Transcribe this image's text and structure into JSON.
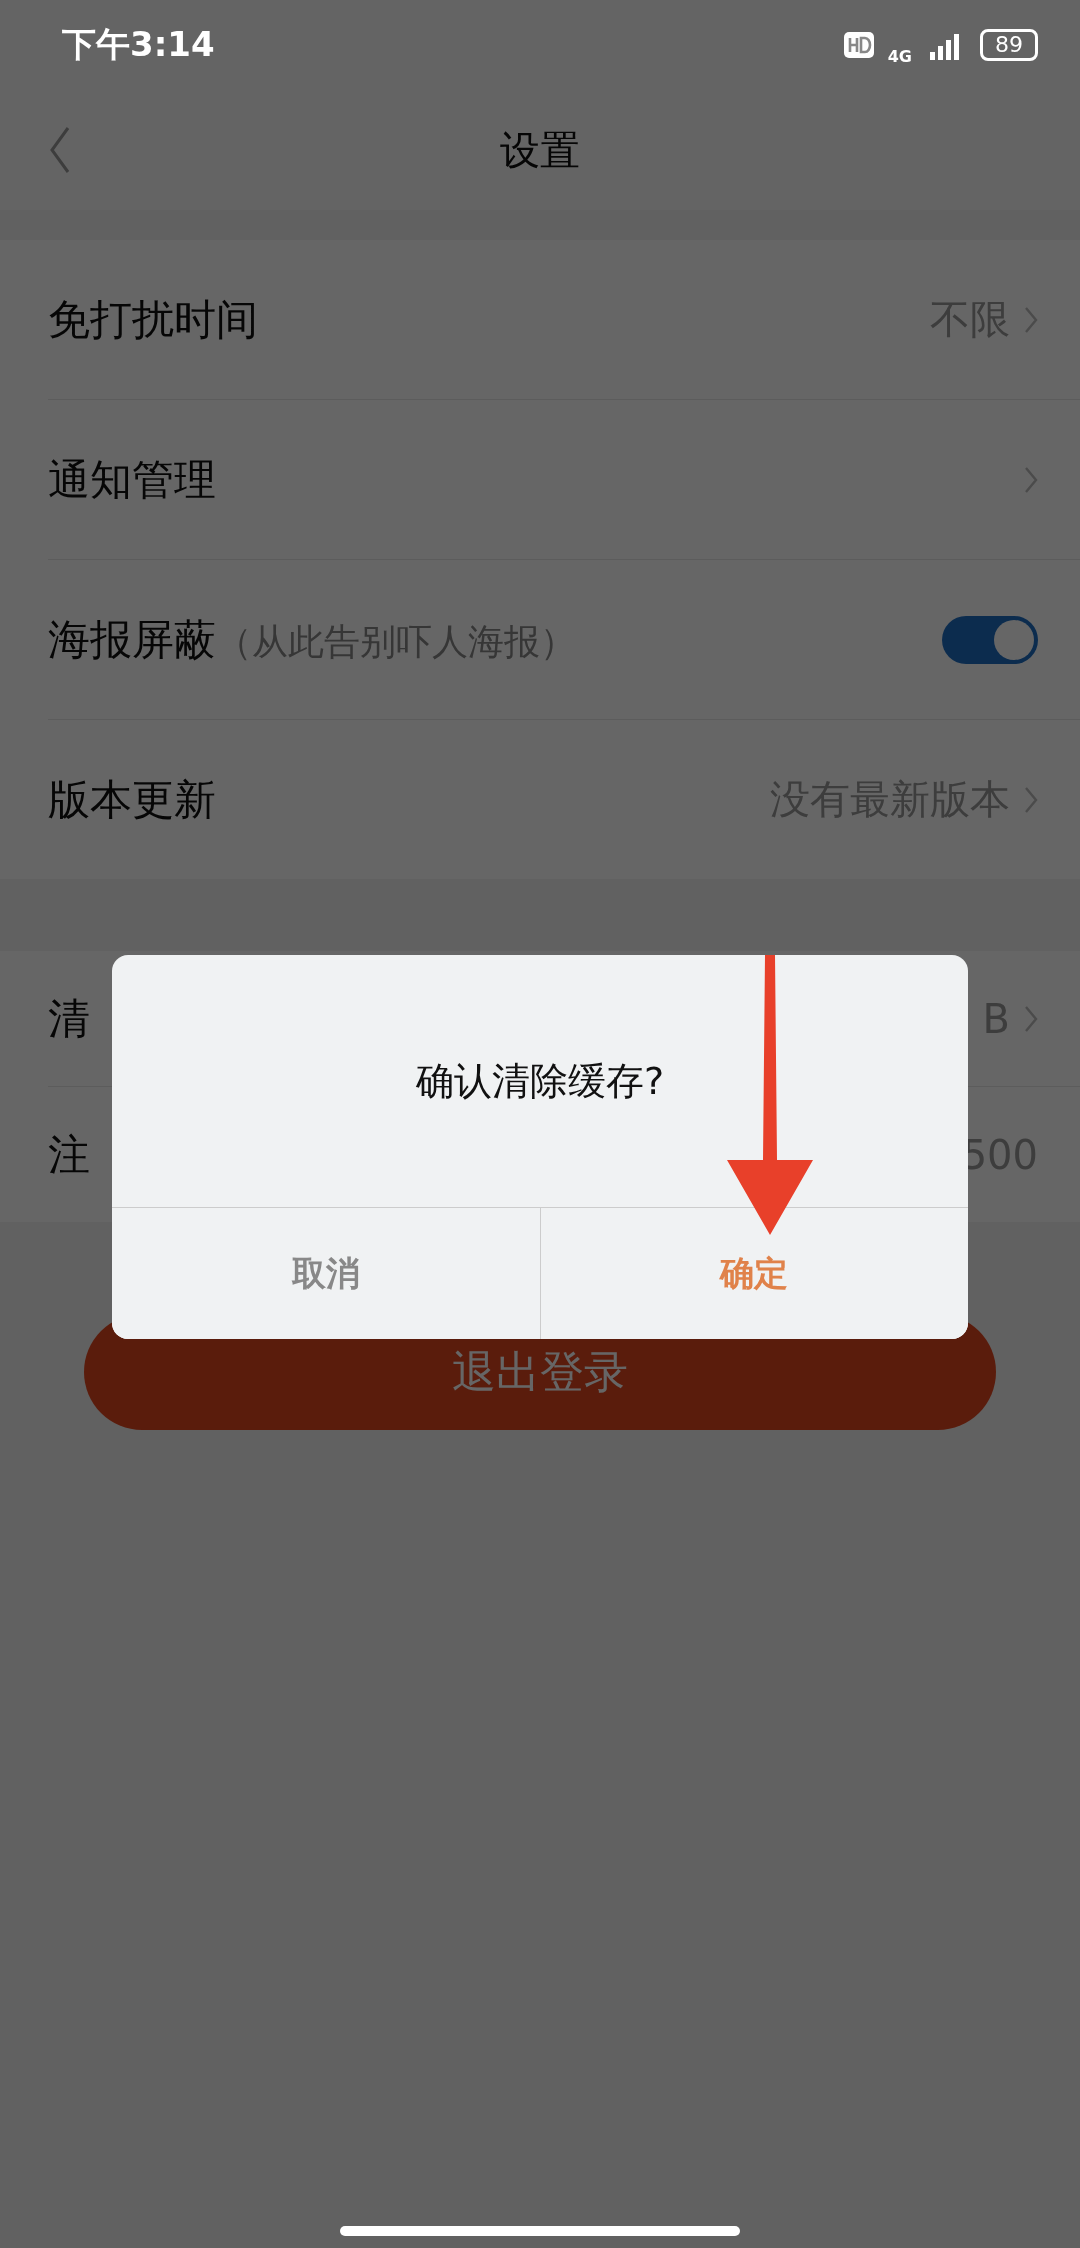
{
  "status_bar": {
    "time": "下午3:14",
    "network": "4G",
    "battery": "89"
  },
  "nav": {
    "title": "设置"
  },
  "sections": [
    {
      "rows": [
        {
          "kind": "value",
          "label": "免打扰时间",
          "value": "不限",
          "chevron": true
        },
        {
          "kind": "value",
          "label": "通知管理",
          "chevron": true
        },
        {
          "kind": "toggle",
          "label": "海报屏蔽",
          "note": "（从此告别吓人海报）",
          "on": true
        },
        {
          "kind": "value",
          "label": "版本更新",
          "value": "没有最新版本",
          "chevron": true
        }
      ]
    },
    {
      "rows": [
        {
          "kind": "value",
          "label": "清",
          "value": "B",
          "chevron": true
        },
        {
          "kind": "value",
          "label": "注",
          "value": "500",
          "chevron": false
        }
      ]
    }
  ],
  "logout_button": "退出登录",
  "dialog": {
    "message": "确认清除缓存?",
    "buttons": [
      {
        "label": "取消",
        "kind": "cancel"
      },
      {
        "label": "确定",
        "kind": "confirm"
      }
    ]
  }
}
